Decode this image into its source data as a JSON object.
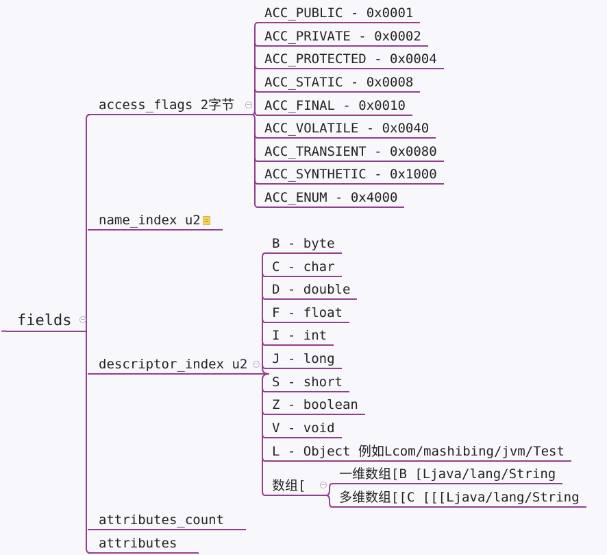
{
  "root": {
    "label": "fields"
  },
  "branches": {
    "access_flags": {
      "label": "access_flags 2字节",
      "children": [
        "ACC_PUBLIC - 0x0001",
        "ACC_PRIVATE - 0x0002",
        "ACC_PROTECTED - 0x0004",
        "ACC_STATIC - 0x0008",
        "ACC_FINAL - 0x0010",
        "ACC_VOLATILE - 0x0040",
        "ACC_TRANSIENT - 0x0080",
        "ACC_SYNTHETIC - 0x1000",
        "ACC_ENUM - 0x4000"
      ]
    },
    "name_index": {
      "label": "name_index u2"
    },
    "descriptor_index": {
      "label": "descriptor_index u2",
      "children": [
        "B - byte",
        "C - char",
        "D - double",
        "F - float",
        "I - int",
        "J - long",
        "S - short",
        "Z - boolean",
        "V - void",
        "L - Object 例如Lcom/mashibing/jvm/Test"
      ],
      "array": {
        "label": "数组[",
        "children": [
          "一维数组[B [Ljava/lang/String",
          "多维数组[[C [[[Ljava/lang/String"
        ]
      }
    },
    "attributes_count": {
      "label": "attributes_count"
    },
    "attributes": {
      "label": "attributes"
    }
  },
  "colors": {
    "line": "#8e3f8e",
    "background": "#f8f8fc",
    "text": "#222222"
  }
}
